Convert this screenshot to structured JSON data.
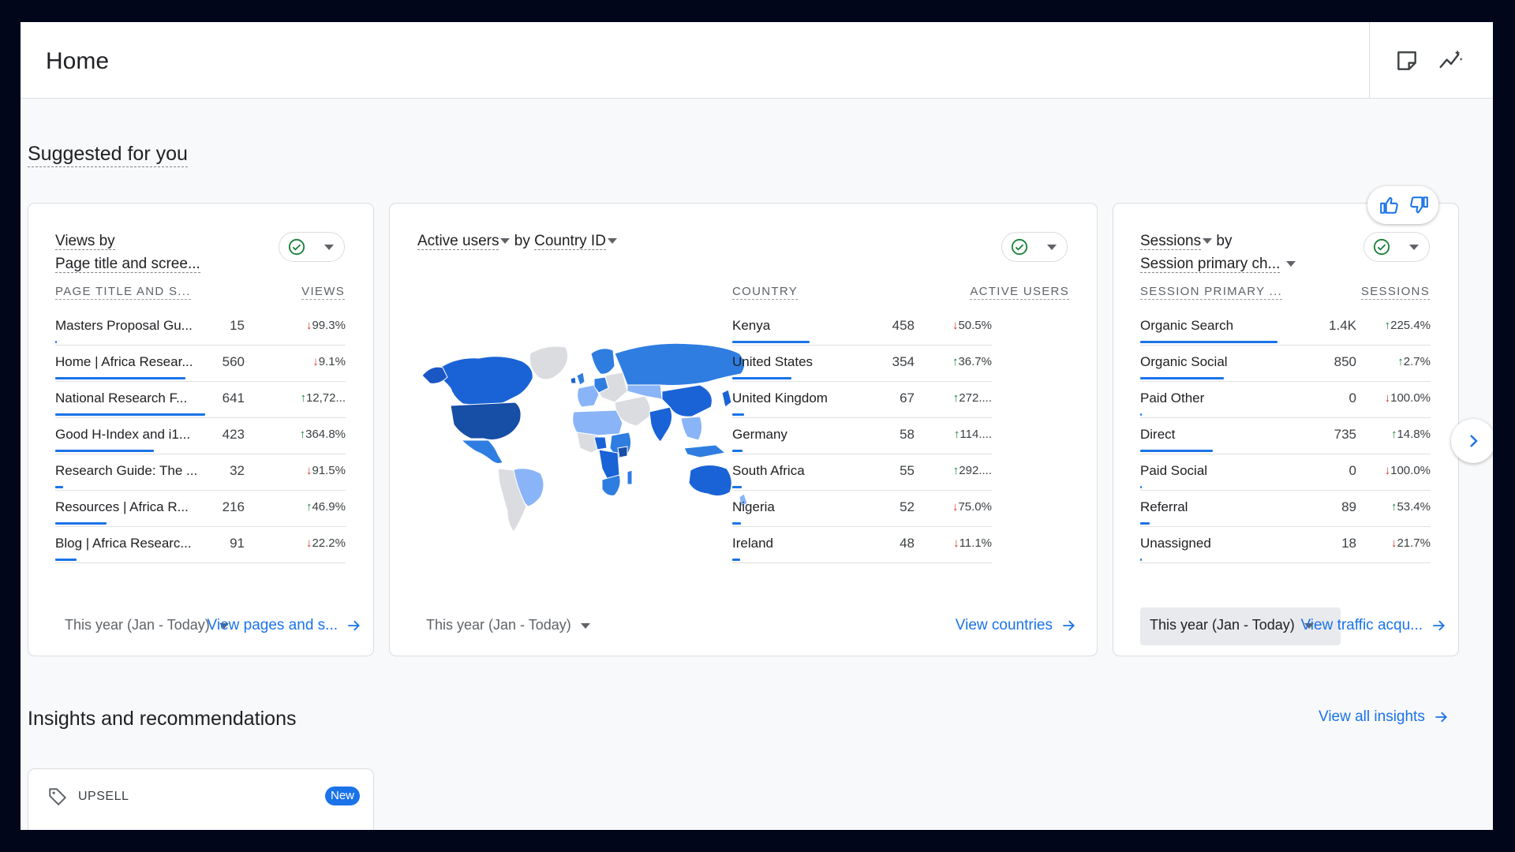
{
  "header": {
    "title": "Home",
    "icons": [
      "notes-icon",
      "insights-icon"
    ]
  },
  "suggested": {
    "title": "Suggested for you"
  },
  "cards": [
    {
      "title_line1": "Views by",
      "title_line2": "Page title and scree...",
      "col1": "PAGE TITLE AND S...",
      "col2": "VIEWS",
      "rows": [
        {
          "label": "Masters Proposal Gu...",
          "value": "15",
          "dir": "down",
          "change": "99.3%",
          "bar": 0.01
        },
        {
          "label": "Home | Africa Resear...",
          "value": "560",
          "dir": "down",
          "change": "9.1%",
          "bar": 0.87
        },
        {
          "label": "National Research F...",
          "value": "641",
          "dir": "up",
          "change": "12,72...",
          "bar": 1.0
        },
        {
          "label": "Good H-Index and i1...",
          "value": "423",
          "dir": "up",
          "change": "364.8%",
          "bar": 0.66
        },
        {
          "label": "Research Guide: The ...",
          "value": "32",
          "dir": "down",
          "change": "91.5%",
          "bar": 0.05
        },
        {
          "label": "Resources | Africa R...",
          "value": "216",
          "dir": "up",
          "change": "46.9%",
          "bar": 0.34
        },
        {
          "label": "Blog | Africa Researc...",
          "value": "91",
          "dir": "down",
          "change": "22.2%",
          "bar": 0.14
        }
      ],
      "date_range": "This year (Jan - Today)",
      "link": "View pages and s..."
    },
    {
      "title_metric": "Active users",
      "title_by": "by",
      "title_dim": "Country ID",
      "col1": "COUNTRY",
      "col2": "ACTIVE USERS",
      "rows": [
        {
          "label": "Kenya",
          "value": "458",
          "dir": "down",
          "change": "50.5%",
          "bar": 1.0
        },
        {
          "label": "United States",
          "value": "354",
          "dir": "up",
          "change": "36.7%",
          "bar": 0.77
        },
        {
          "label": "United Kingdom",
          "value": "67",
          "dir": "up",
          "change": "272....",
          "bar": 0.15
        },
        {
          "label": "Germany",
          "value": "58",
          "dir": "up",
          "change": "114....",
          "bar": 0.13
        },
        {
          "label": "South Africa",
          "value": "55",
          "dir": "up",
          "change": "292....",
          "bar": 0.12
        },
        {
          "label": "Nigeria",
          "value": "52",
          "dir": "down",
          "change": "75.0%",
          "bar": 0.11
        },
        {
          "label": "Ireland",
          "value": "48",
          "dir": "down",
          "change": "11.1%",
          "bar": 0.1
        }
      ],
      "date_range": "This year (Jan - Today)",
      "link": "View countries"
    },
    {
      "title_metric": "Sessions",
      "title_by": "by",
      "title_dim": "Session primary ch...",
      "col1": "SESSION PRIMARY ...",
      "col2": "SESSIONS",
      "rows": [
        {
          "label": "Organic Search",
          "value": "1.4K",
          "dir": "up",
          "change": "225.4%",
          "bar": 1.0
        },
        {
          "label": "Organic Social",
          "value": "850",
          "dir": "up",
          "change": "2.7%",
          "bar": 0.61
        },
        {
          "label": "Paid Other",
          "value": "0",
          "dir": "down",
          "change": "100.0%",
          "bar": 0.0
        },
        {
          "label": "Direct",
          "value": "735",
          "dir": "up",
          "change": "14.8%",
          "bar": 0.53
        },
        {
          "label": "Paid Social",
          "value": "0",
          "dir": "down",
          "change": "100.0%",
          "bar": 0.0
        },
        {
          "label": "Referral",
          "value": "89",
          "dir": "up",
          "change": "53.4%",
          "bar": 0.07
        },
        {
          "label": "Unassigned",
          "value": "18",
          "dir": "down",
          "change": "21.7%",
          "bar": 0.01
        }
      ],
      "date_range": "This year (Jan - Today)",
      "link": "View traffic acqu..."
    }
  ],
  "insights": {
    "title": "Insights and recommendations",
    "link": "View all insights",
    "card_label": "UPSELL",
    "badge": "New"
  },
  "colors": {
    "accent": "#1a73e8",
    "up": "#188038",
    "down": "#d93025",
    "map_dark": "#1a56c4",
    "map_mid": "#2f7de1",
    "map_light": "#8ab4f8",
    "map_none": "#dadce0"
  }
}
